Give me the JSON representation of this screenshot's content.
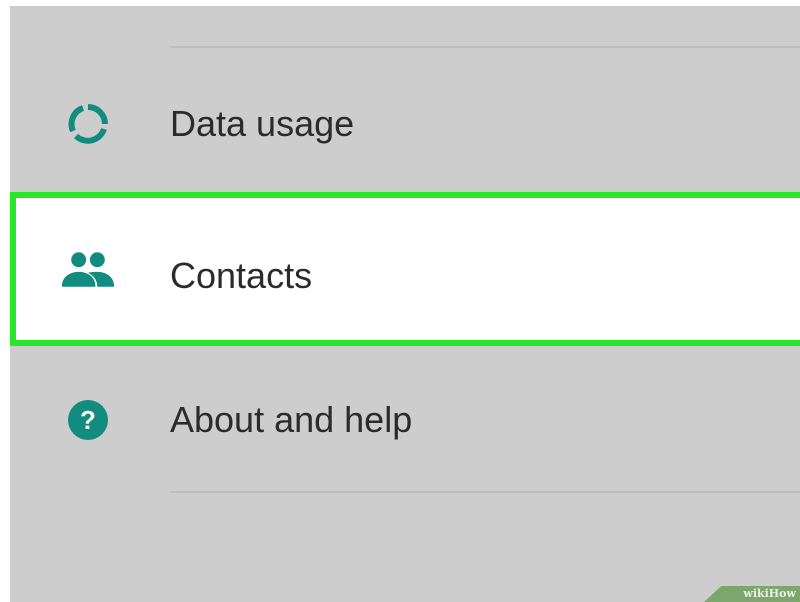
{
  "settings": {
    "items": [
      {
        "id": "data-usage",
        "label": "Data usage",
        "icon": "data-usage-icon"
      },
      {
        "id": "contacts",
        "label": "Contacts",
        "icon": "contacts-icon",
        "highlighted": true
      },
      {
        "id": "about-help",
        "label": "About and help",
        "icon": "help-icon"
      }
    ]
  },
  "colors": {
    "accent": "#128c7e",
    "highlight": "#28e628",
    "background": "#cdcdcd",
    "selected_row": "#ffffff"
  },
  "watermark": "wikiHow"
}
